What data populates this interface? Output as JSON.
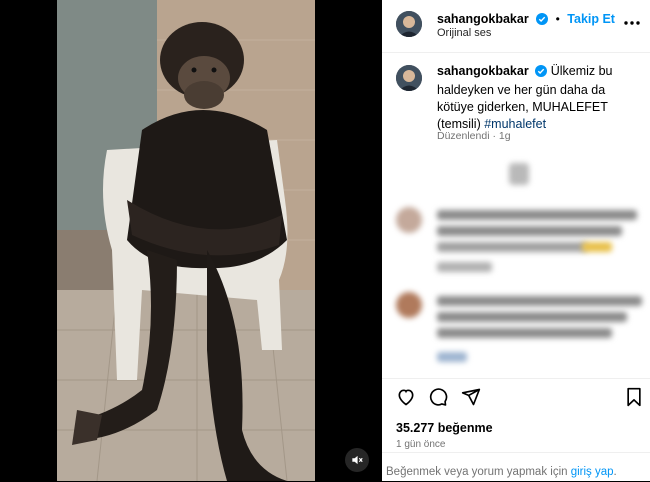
{
  "post": {
    "username": "sahangokbakar",
    "follow_label": "Takip Et",
    "subtitle": "Orijinal ses",
    "caption_text": "Ülkemiz bu haldeyken ve her gün daha da kötüye giderken, MUHALEFET (temsili) ",
    "caption_hashtag": "#muhalefet",
    "edited_label": "Düzenlendi",
    "edited_age": "1g",
    "likes": "35.277 beğenme",
    "time_ago": "1 gün önce",
    "footer_prefix": "Beğenmek veya yorum yapmak için ",
    "footer_link": "giriş yap",
    "footer_suffix": "."
  },
  "icons": {
    "verified": "verified-badge-icon",
    "more": "more-options-icon",
    "like": "heart-icon",
    "comment": "comment-icon",
    "share": "share-icon",
    "save": "bookmark-icon",
    "mute": "speaker-muted-icon"
  },
  "colors": {
    "accent": "#0095f6",
    "hashtag": "#00376b",
    "muted_text": "#737373"
  }
}
